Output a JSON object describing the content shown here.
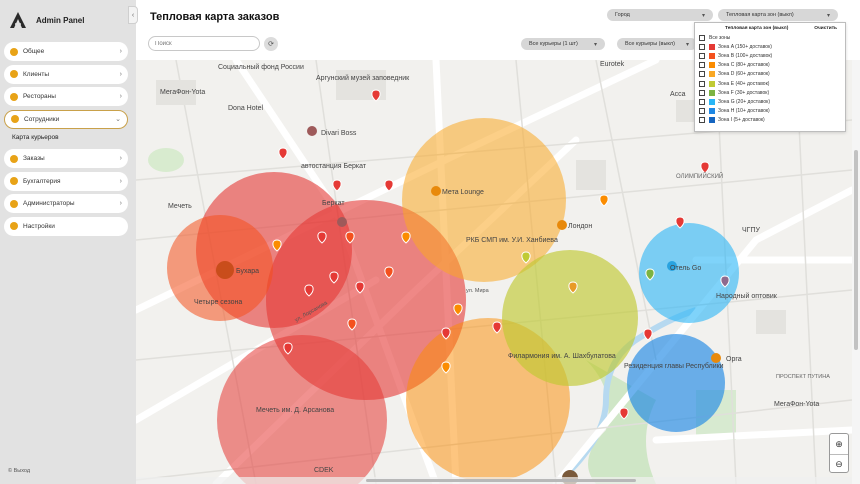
{
  "app": {
    "title": "Admin Panel"
  },
  "sidebar": {
    "items": [
      {
        "label": "Общее"
      },
      {
        "label": "Клиенты"
      },
      {
        "label": "Рестораны"
      },
      {
        "label": "Сотрудники"
      },
      {
        "label": "Заказы"
      },
      {
        "label": "Бухгалтерия"
      },
      {
        "label": "Администраторы"
      },
      {
        "label": "Настройки"
      }
    ],
    "sub_item": "Карта курьеров",
    "footer": "© Выход"
  },
  "header": {
    "title": "Тепловая карта заказов",
    "search_placeholder": "Поиск",
    "city_select": "Город",
    "zone_select": "Тепловая карта зон (выкл)",
    "courier_filter_1": "Все курьеры (1 шт)",
    "courier_filter_2": "Все курьеры (выкл)"
  },
  "legend": {
    "header_left": "Тепловая карта зон (выкл)",
    "header_right": "Очистить",
    "all_label": "Все зоны",
    "zones": [
      {
        "label": "Зона A (150+ доставок)",
        "color": "#e53935"
      },
      {
        "label": "Зона B (100+ доставок)",
        "color": "#f4511e"
      },
      {
        "label": "Зона C (80+ доставок)",
        "color": "#fb8c00"
      },
      {
        "label": "Зона D (60+ доставок)",
        "color": "#f9a825"
      },
      {
        "label": "Зона E (40+ доставок)",
        "color": "#c0ca33"
      },
      {
        "label": "Зона F (30+ доставок)",
        "color": "#7cb342"
      },
      {
        "label": "Зона G (20+ доставок)",
        "color": "#29b6f6"
      },
      {
        "label": "Зона H (10+ доставок)",
        "color": "#1e88e5"
      },
      {
        "label": "Зона I (5+ доставок)",
        "color": "#1565c0"
      }
    ]
  },
  "map": {
    "labels": [
      "Социальный фонд России",
      "Аргунский музей заповедник",
      "МегаФон-Yota",
      "Dona Hotel",
      "Divari Boss",
      "автостанция Беркат",
      "Беркат",
      "Мечеть",
      "Мета Lounge",
      "РКБ СМП им. У.И. Ханбиева",
      "Лондон",
      "Бухара",
      "Четыре сезона",
      "Отель Go",
      "Народный оптовик",
      "ЧГПУ",
      "Филармония им. А. Шахбулатова",
      "Резиденция главы Республики",
      "Орга",
      "Мечеть им. Д. Арсанова",
      "CDEK",
      "МегаФон-Yota",
      "Eurotek",
      "Асса",
      "ОЛИМПИЙСКИЙ",
      "ПРОСПЕКТ ПУТИНА",
      "ул. Лорсанова",
      "ул. Мира"
    ]
  }
}
